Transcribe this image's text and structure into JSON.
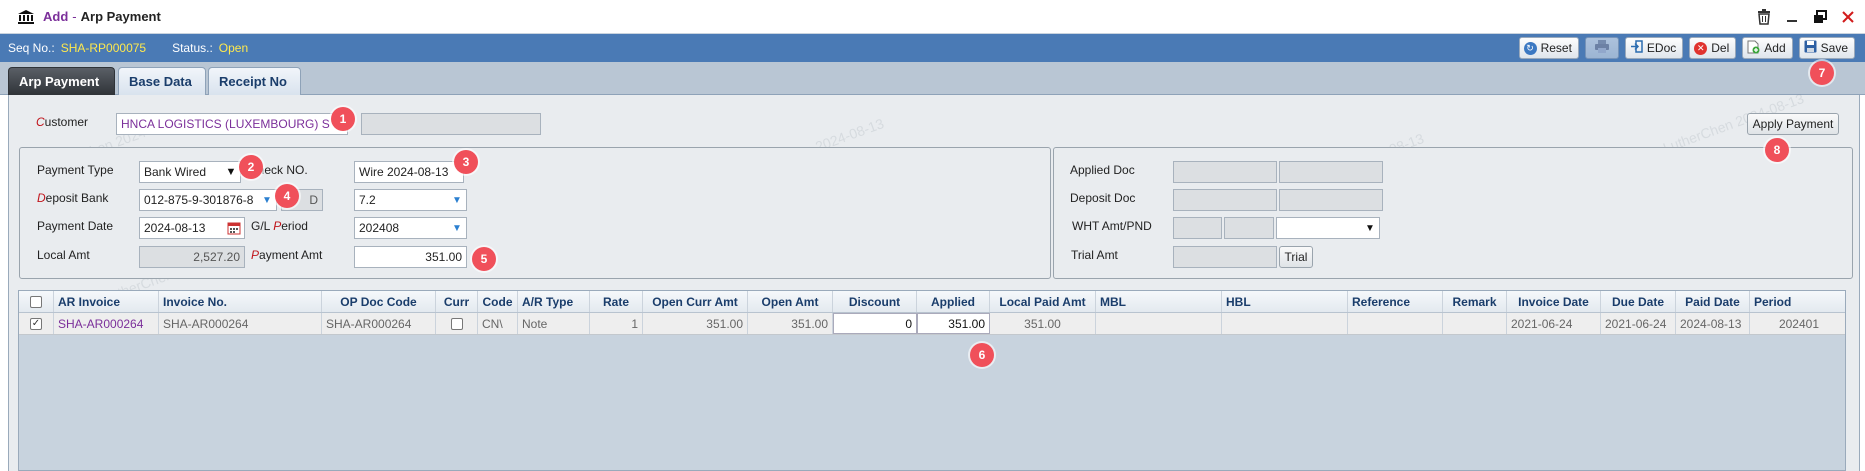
{
  "window": {
    "title_prefix": "Add",
    "title_sep": "-",
    "title": "Arp Payment",
    "icons": [
      "bank-icon",
      "trash-icon",
      "minimize-icon",
      "restore-icon",
      "close-icon"
    ]
  },
  "status": {
    "seq_label": "Seq No.:",
    "seq_value": "SHA-RP000075",
    "status_label": "Status.:",
    "status_value": "Open"
  },
  "toolbar": {
    "reset": "Reset",
    "edoc": "EDoc",
    "del": "Del",
    "add": "Add",
    "save": "Save"
  },
  "tabs": [
    {
      "label": "Arp Payment",
      "active": true
    },
    {
      "label": "Base Data",
      "active": false
    },
    {
      "label": "Receipt No",
      "active": false
    }
  ],
  "form": {
    "customer_label_first": "C",
    "customer_label_rest": "ustomer",
    "customer_value": "HNCA LOGISTICS (LUXEMBOURG) S",
    "apply_payment": "Apply Payment",
    "payment_type_label": "Payment Type",
    "payment_type_value": "Bank Wired",
    "check_no_label": "Check NO.",
    "check_no_value": "Wire 2024-08-13",
    "deposit_bank_label_first": "D",
    "deposit_bank_label_rest": "eposit Bank",
    "deposit_bank_value": "012-875-9-301876-8",
    "deposit_small_value": "D",
    "rate_value": "7.2",
    "payment_date_label": "Payment Date",
    "payment_date_value": "2024-08-13",
    "gl_period_label_a": "G/L ",
    "gl_period_label_first": "P",
    "gl_period_label_rest": "eriod",
    "gl_period_value": "202408",
    "local_amt_label": "Local Amt",
    "local_amt_value": "2,527.20",
    "payment_amt_label_first": "P",
    "payment_amt_label_rest": "ayment Amt",
    "payment_amt_value": "351.00",
    "applied_doc_label": "Applied Doc",
    "deposit_doc_label": "Deposit Doc",
    "wht_label": "WHT Amt/PND",
    "trial_amt_label": "Trial Amt",
    "trial_button": "Trial"
  },
  "grid": {
    "columns": [
      "AR Invoice",
      "Invoice No.",
      "OP Doc Code",
      "Curr",
      "Code",
      "A/R Type",
      "Rate",
      "Open Curr Amt",
      "Open Amt",
      "Discount",
      "Applied",
      "Local Paid Amt",
      "MBL",
      "HBL",
      "Reference",
      "Remark",
      "Invoice Date",
      "Due Date",
      "Paid Date",
      "Period"
    ],
    "rows": [
      {
        "ar_invoice": "SHA-AR000264",
        "invoice_no": "SHA-AR000264",
        "op_doc_code": "SHA-AR000264",
        "code": "CN\\",
        "ar_type": "Note",
        "rate": "1",
        "open_curr_amt": "351.00",
        "open_amt": "351.00",
        "discount": "0",
        "applied": "351.00",
        "local_paid_amt": "351.00",
        "mbl": "",
        "hbl": "",
        "reference": "",
        "remark": "",
        "invoice_date": "2021-06-24",
        "due_date": "2021-06-24",
        "paid_date": "2024-08-13",
        "period": "202401"
      }
    ]
  },
  "markers": [
    "1",
    "2",
    "3",
    "4",
    "5",
    "6",
    "7",
    "8"
  ],
  "watermark": "LutherChen 2024-08-13",
  "colors": {
    "status_bar": "#4a7ab5",
    "status_value": "#ffe94d",
    "title_purple": "#7b2f9a",
    "required_red": "#c0141b",
    "marker": "#f0505a"
  }
}
